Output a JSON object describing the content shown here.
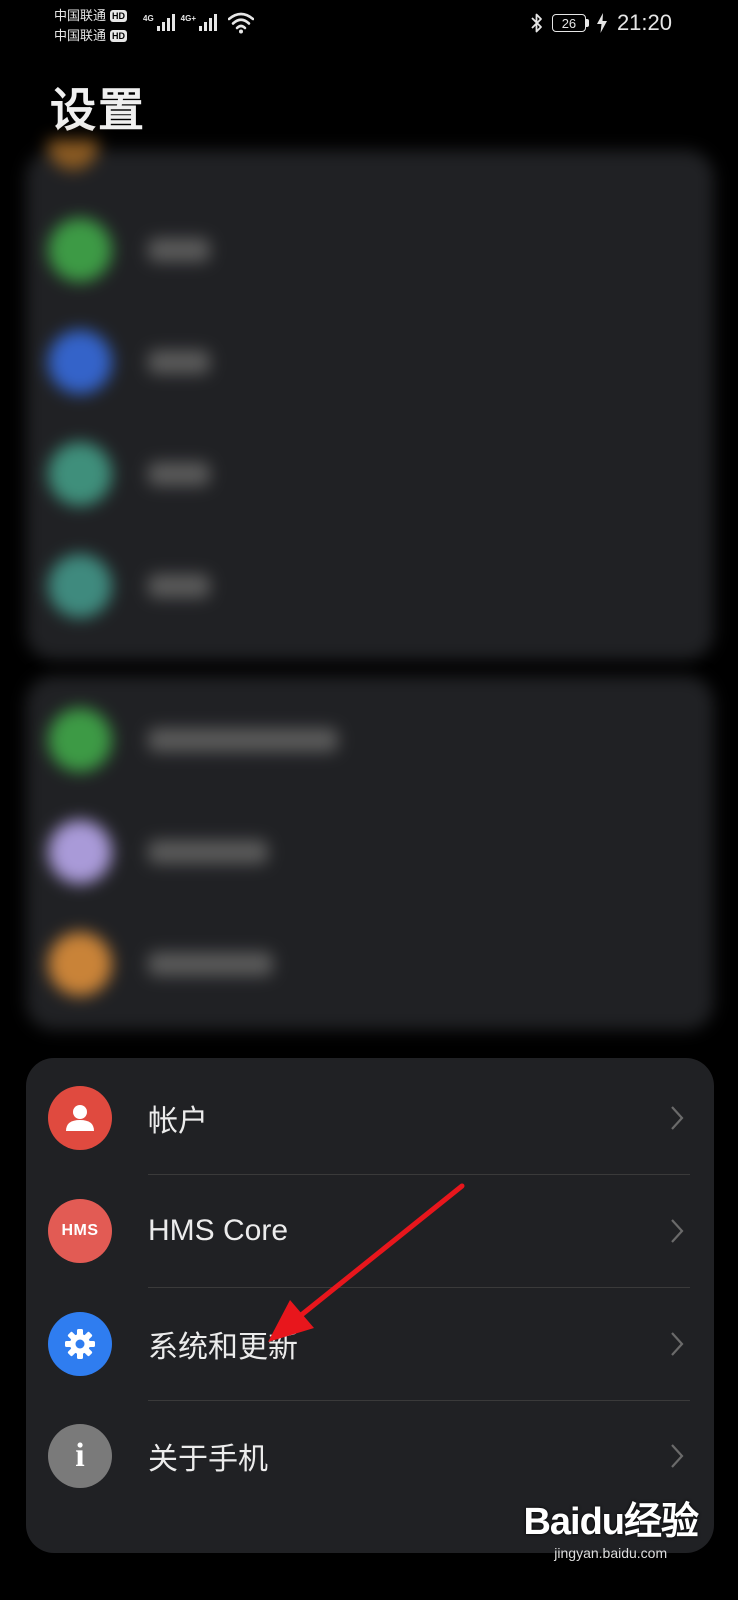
{
  "status_bar": {
    "carrier_1": "中国联通",
    "carrier_2": "中国联通",
    "hd_label": "HD",
    "network_1": "4G",
    "network_2": "4G+",
    "battery_level": "26",
    "time": "21:20"
  },
  "page": {
    "title": "设置"
  },
  "colors": {
    "background": "#000000",
    "card": "#202124",
    "account_icon": "#e04a3f",
    "hms_icon": "#e25b54",
    "system_icon": "#2f7df0",
    "about_icon": "#7a7a7a",
    "arrow": "#e8161c"
  },
  "settings_list": [
    {
      "label": "帐户",
      "icon": "person-icon"
    },
    {
      "label": "HMS Core",
      "icon": "hms-icon",
      "icon_text": "HMS"
    },
    {
      "label": "系统和更新",
      "icon": "gear-icon"
    },
    {
      "label": "关于手机",
      "icon": "info-icon",
      "icon_text": "i"
    }
  ],
  "watermark": {
    "logo": "Baidu经验",
    "url": "jingyan.baidu.com"
  }
}
